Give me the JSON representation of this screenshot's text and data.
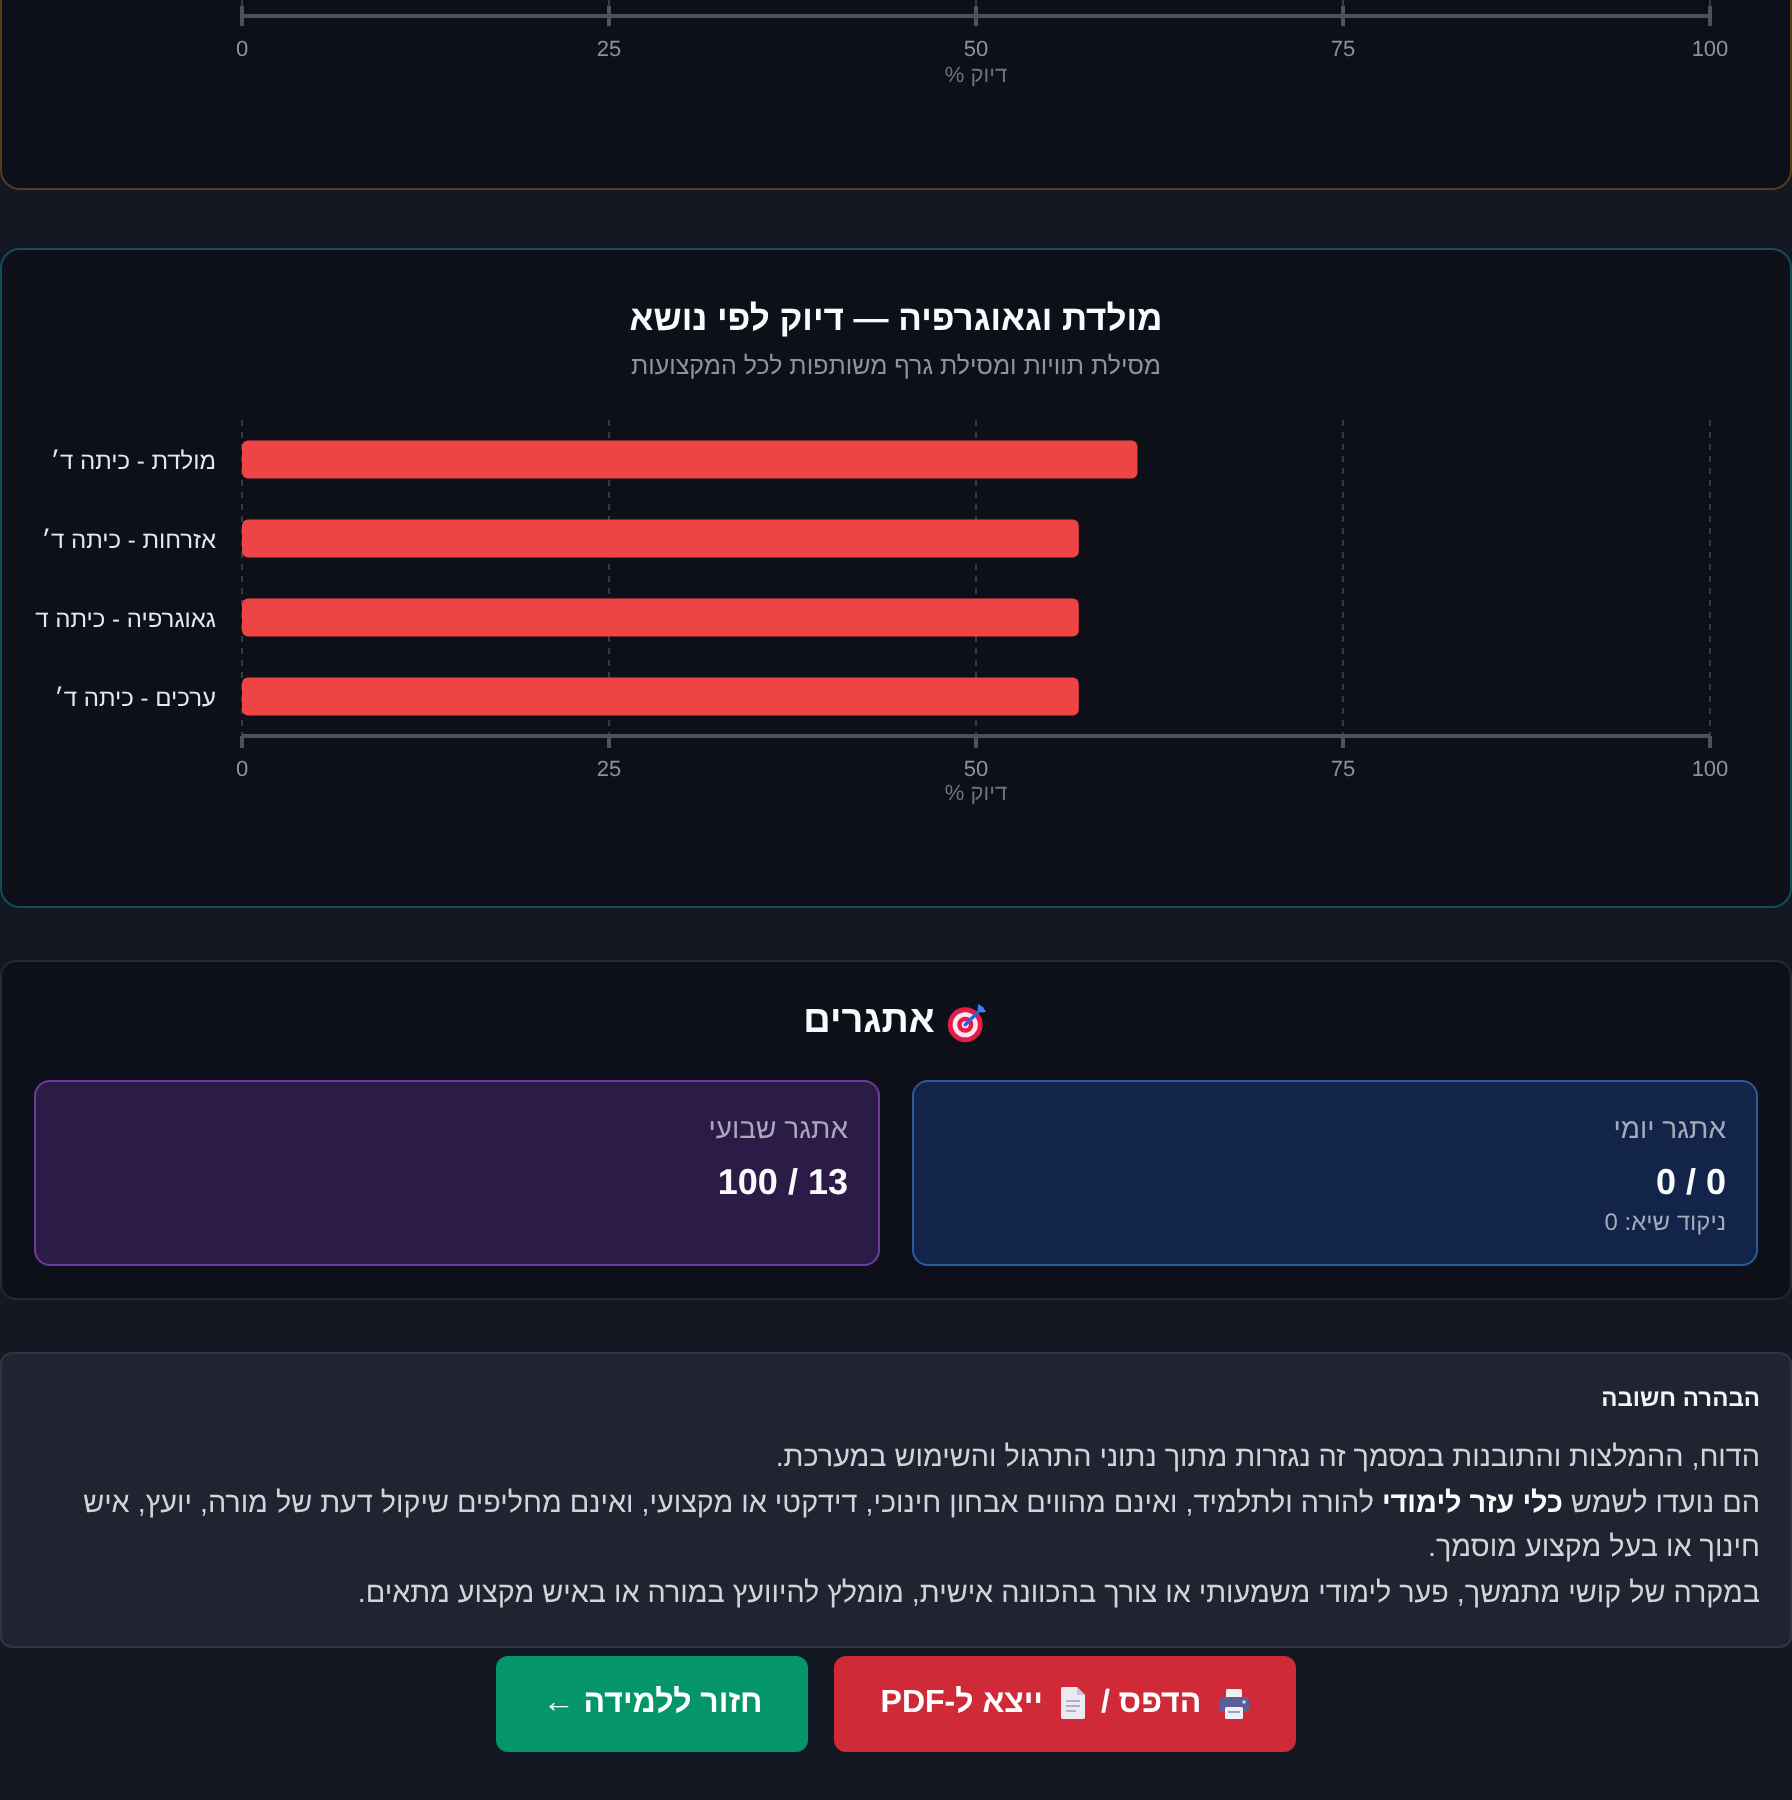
{
  "upper_chart": {
    "axis": {
      "tick_labels": [
        "100",
        "75",
        "50",
        "25",
        "0"
      ],
      "title": "דיוק %"
    }
  },
  "subject_chart": {
    "title": "מולדת וגאוגרפיה — דיוק לפי נושא",
    "subtitle": "מסילת תוויות ומסילת גרף משותפות לכל המקצועות",
    "chart_data": {
      "type": "bar",
      "orientation": "horizontal",
      "categories": [
        "מולדת - כיתה ד׳",
        "אזרחות - כיתה ד׳",
        "גאוגרפיה - כיתה ד",
        "ערכים - כיתה ד׳"
      ],
      "values": [
        61,
        57,
        57,
        57
      ],
      "xlabel": "דיוק %",
      "xlim": [
        0,
        100
      ],
      "xticks": [
        0,
        25,
        50,
        75,
        100
      ],
      "grid": true
    }
  },
  "challenges": {
    "title": "אתגרים",
    "items": [
      {
        "kind": "daily",
        "label": "אתגר יומי",
        "count": "0 / 0",
        "best_score": "ניקוד שיא: 0"
      },
      {
        "kind": "weekly",
        "label": "אתגר שבועי",
        "count": "13 / 100"
      }
    ]
  },
  "disclaimer": {
    "title": "הבהרה חשובה",
    "paragraphs": [
      "הדוח, ההמלצות והתובנות במסמך זה נגזרות מתוך נתוני התרגול והשימוש במערכת.",
      "הם נועדו לשמש **כלי עזר לימודי** להורה ולתלמיד, ואינם מהווים אבחון חינוכי, דידקטי או מקצועי, ואינם מחליפים שיקול דעת של מורה, יועץ, איש חינוך או בעל מקצוע מוסמך.",
      "במקרה של קושי מתמשך, פער לימודי משמעותי או צורך בהכוונה אישית, מומלץ להיוועץ במורה או באיש מקצוע מתאים."
    ]
  },
  "buttons": [
    {
      "kind": "print",
      "label_parts": [
        "הדפס /",
        "ייצא ל-PDF"
      ]
    },
    {
      "kind": "back",
      "label": "חזור ללמידה ←"
    }
  ]
}
